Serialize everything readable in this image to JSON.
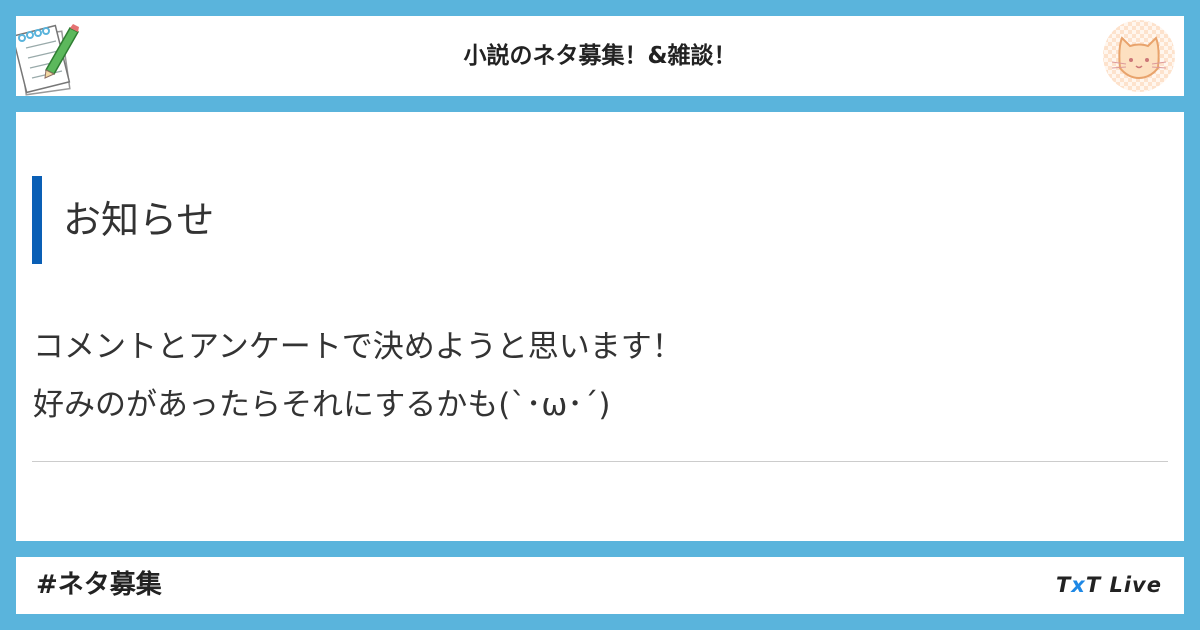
{
  "header": {
    "title": "小説のネタ募集！&雑談！",
    "left_icon": "notebook-pencil-icon",
    "right_icon": "cat-face-icon"
  },
  "main": {
    "heading": "お知らせ",
    "body_lines": [
      "コメントとアンケートで決めようと思います！",
      "好みのがあったらそれにするかも(`･ω･´)"
    ]
  },
  "footer": {
    "tag": "#ネタ募集",
    "brand_prefix": "T",
    "brand_x": "x",
    "brand_suffix": "T Live"
  },
  "colors": {
    "background": "#5ab4dc",
    "accent_bar": "#0a5fb5",
    "brand_x": "#1e88e5"
  }
}
